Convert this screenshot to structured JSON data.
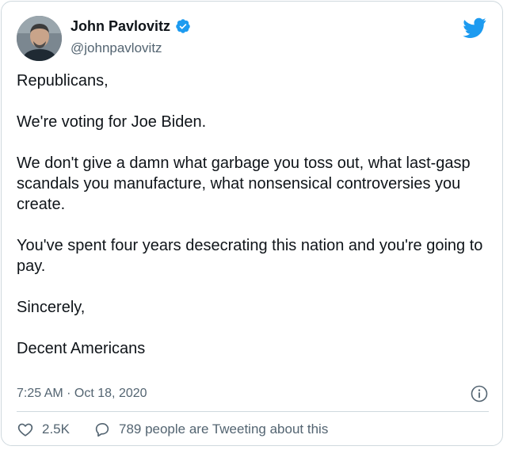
{
  "author": {
    "display_name": "John Pavlovitz",
    "handle": "@johnpavlovitz",
    "verified": true,
    "verified_icon": "verified-badge-icon",
    "avatar": "profile-photo"
  },
  "platform_icon": "twitter-bird-icon",
  "tweet": {
    "paragraphs": [
      "Republicans,",
      "We're voting for Joe Biden.",
      "We don't give a damn what garbage you toss out, what last-gasp scandals you manufacture, what nonsensical controversies you create.",
      "You've spent four years desecrating this nation and you're going to pay.",
      "Sincerely,",
      "Decent Americans"
    ],
    "timestamp": "7:25 AM · Oct 18, 2020"
  },
  "actions": {
    "likes": "2.5K",
    "like_icon": "heart-icon",
    "conversation": "789 people are Tweeting about this",
    "conversation_icon": "speech-bubble-icon",
    "info_icon": "info-icon"
  },
  "colors": {
    "brand_blue": "#1d9bf0",
    "text": "#0f1419",
    "secondary": "#536471",
    "border": "#cfd9de"
  }
}
